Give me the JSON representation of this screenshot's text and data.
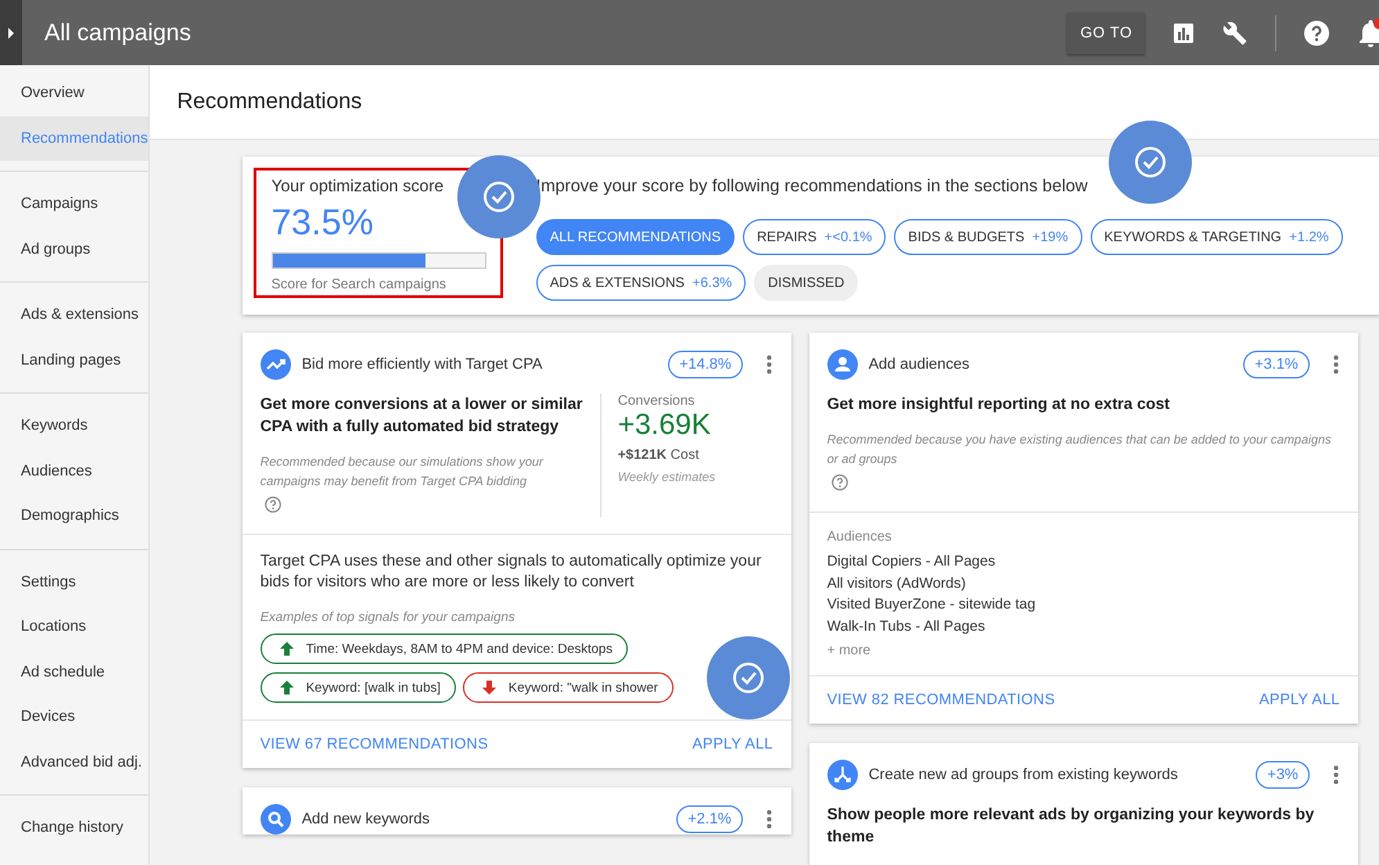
{
  "top_bar": {
    "title": "All campaigns",
    "goto_label": "GO TO"
  },
  "sidebar": {
    "groups": [
      {
        "items": [
          {
            "label": "Overview",
            "selected": false
          },
          {
            "label": "Recommendations",
            "selected": true
          }
        ]
      },
      {
        "items": [
          {
            "label": "Campaigns",
            "selected": false
          },
          {
            "label": "Ad groups",
            "selected": false
          }
        ]
      },
      {
        "items": [
          {
            "label": "Ads & extensions",
            "selected": false
          },
          {
            "label": "Landing pages",
            "selected": false
          }
        ]
      },
      {
        "items": [
          {
            "label": "Keywords",
            "selected": false
          },
          {
            "label": "Audiences",
            "selected": false
          },
          {
            "label": "Demographics",
            "selected": false
          }
        ]
      },
      {
        "items": [
          {
            "label": "Settings",
            "selected": false
          },
          {
            "label": "Locations",
            "selected": false
          },
          {
            "label": "Ad schedule",
            "selected": false
          },
          {
            "label": "Devices",
            "selected": false
          },
          {
            "label": "Advanced bid adj.",
            "selected": false
          }
        ]
      },
      {
        "items": [
          {
            "label": "Change history",
            "selected": false
          }
        ]
      }
    ]
  },
  "page_title": "Recommendations",
  "score": {
    "title": "Your optimization score",
    "value": "73.5%",
    "level": 0.72,
    "caption": "Score for Search campaigns",
    "highlighted": true
  },
  "improve_text": "Improve your score by following recommendations in the sections below",
  "filters": [
    {
      "label": "ALL RECOMMENDATIONS",
      "kind": "category",
      "selected": true
    },
    {
      "label": "REPAIRS",
      "delta": "+<0.1%",
      "kind": "category",
      "selected": false
    },
    {
      "label": "BIDS & BUDGETS",
      "delta": "+19%",
      "kind": "category",
      "selected": false
    },
    {
      "label": "KEYWORDS & TARGETING",
      "delta": "+1.2%",
      "kind": "category",
      "selected": false
    },
    {
      "label": "ADS & EXTENSIONS",
      "delta": "+6.3%",
      "kind": "category",
      "selected": false
    },
    {
      "label": "DISMISSED",
      "kind": "dismissed",
      "selected": false
    }
  ],
  "columns": [
    [
      {
        "kind": "trend",
        "title": "Bid more efficiently with Target CPA",
        "delta": "+14.8%",
        "headline": "Get more conversions at a lower or similar CPA with a fully automated bid strategy",
        "reason": "Recommended because our simulations show your campaigns may benefit from Target CPA bidding",
        "stats": {
          "label": "Conversions",
          "value": "+3.69K",
          "cost": "**+$121K** Cost",
          "note": "Weekly estimates"
        },
        "details": {
          "text": "Target CPA uses these and other signals to automatically optimize your bids for visitors who are more or less likely to convert",
          "label": "Examples of top signals for your campaigns",
          "signals": [
            {
              "text": "Time: Weekdays, 8AM to 4PM and device: Desktops",
              "kind": "up"
            },
            {
              "text": "Keyword: [walk in tubs]",
              "kind": "up"
            },
            {
              "text": "Keyword: \"walk in shower",
              "kind": "down"
            }
          ]
        },
        "view": "VIEW 67 RECOMMENDATIONS",
        "apply": "APPLY ALL"
      },
      {
        "kind": "search",
        "title": "Add new keywords",
        "delta": "+2.1%"
      }
    ],
    [
      {
        "kind": "person",
        "title": "Add audiences",
        "delta": "+3.1%",
        "headline": "Get more insightful reporting at no extra cost",
        "reason": "Recommended because you have existing audiences that can be added to your campaigns or ad groups",
        "audiences": {
          "label": "Audiences",
          "items": [
            "Digital Copiers - All Pages",
            "All visitors (AdWords)",
            "Visited BuyerZone - sitewide tag",
            "Walk-In Tubs - All Pages"
          ],
          "more": "+ more"
        },
        "view": "VIEW 82 RECOMMENDATIONS",
        "apply": "APPLY ALL"
      },
      {
        "kind": "split",
        "title": "Create new ad groups from existing keywords",
        "delta": "+3%",
        "headline": "Show people more relevant ads by organizing your keywords by theme"
      }
    ]
  ]
}
